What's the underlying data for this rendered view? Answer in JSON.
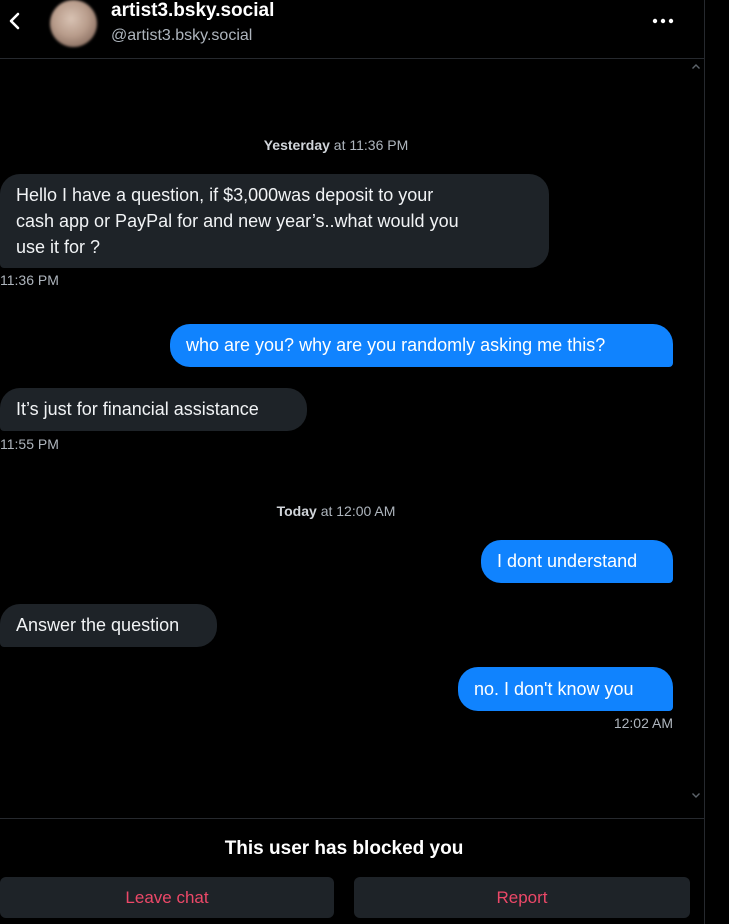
{
  "header": {
    "display_name": "artist3.bsky.social",
    "handle": "@artist3.bsky.social",
    "back_icon": "chevron-left-icon",
    "menu_icon": "more-horizontal-icon"
  },
  "conversation": {
    "separators": [
      {
        "day": "Yesterday",
        "time": "at 11:36 PM"
      },
      {
        "day": "Today",
        "time": "at 12:00 AM"
      }
    ],
    "messages": [
      {
        "direction": "incoming",
        "lines": [
          "Hello I have a question, if $3,000was deposit to your",
          "cash app or PayPal for and new year’s..what would you",
          "use it for ?"
        ],
        "time": "11:36 PM"
      },
      {
        "direction": "outgoing",
        "text": "who are you? why are you randomly asking me this?"
      },
      {
        "direction": "incoming",
        "text": "It’s just for financial assistance",
        "time": "11:55 PM"
      },
      {
        "direction": "outgoing",
        "text": "I dont understand"
      },
      {
        "direction": "incoming",
        "text": "Answer the question"
      },
      {
        "direction": "outgoing",
        "text": "no. I don't know you",
        "time": "12:02 AM"
      }
    ]
  },
  "footer": {
    "blocked_notice": "This user has blocked you",
    "leave_label": "Leave chat",
    "report_label": "Report"
  },
  "colors": {
    "background": "#000000",
    "incoming_bubble": "#1e2328",
    "outgoing_bubble": "#1083fe",
    "danger_text": "#ec4868",
    "muted_text": "#aeb5bd"
  }
}
